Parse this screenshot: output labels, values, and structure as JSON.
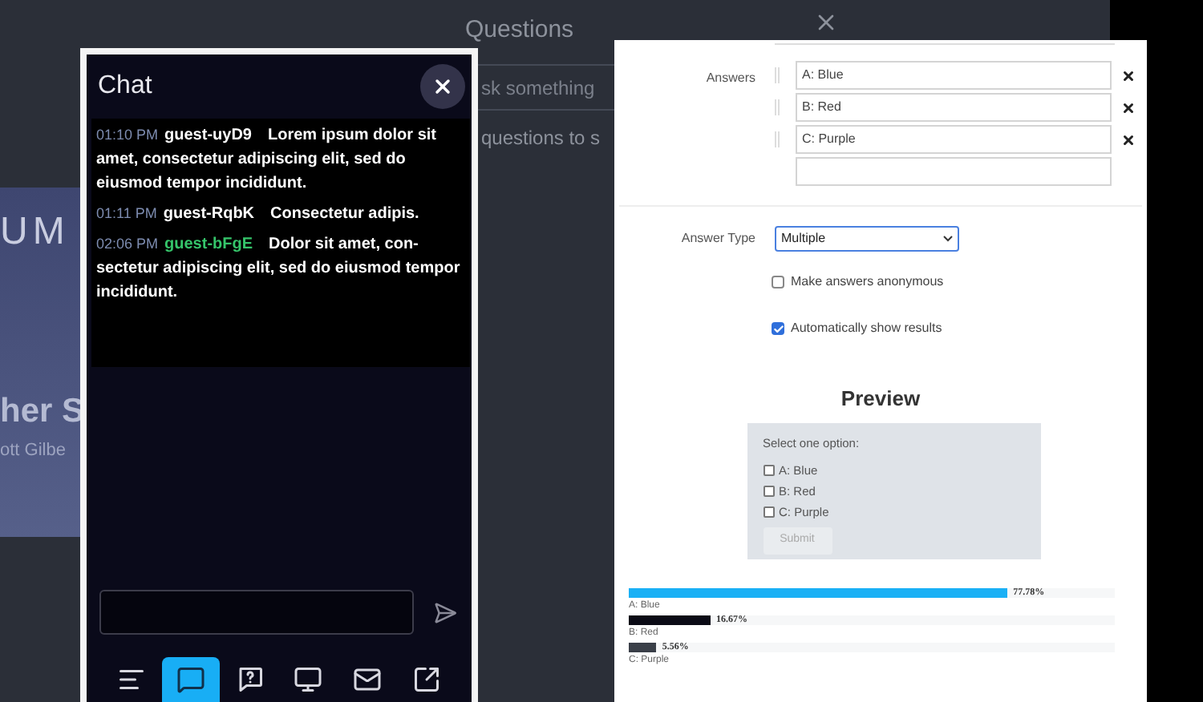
{
  "background": {
    "questions_title": "Questions",
    "question_field_text": "sk something",
    "empty_text": "questions to s",
    "slide_texts": [
      "UM",
      "her S",
      "ott Gilbe"
    ]
  },
  "chat": {
    "title": "Chat",
    "messages": [
      {
        "time": "01:10 PM",
        "user": "guest-uyD9",
        "highlight": false,
        "text": "Lorem ipsum dolor sit amet, consectetur adipiscing elit, sed do eiusmod tempor incididunt."
      },
      {
        "time": "01:11 PM",
        "user": "guest-RqbK",
        "highlight": false,
        "text": "Consectetur adipis."
      },
      {
        "time": "02:06 PM",
        "user": "guest-bFgE",
        "highlight": true,
        "text": "Dolor sit amet, con-sectetur adipiscing elit, sed do eiusmod tempor incididunt."
      }
    ],
    "toolbar": [
      {
        "kind": "list",
        "selected": false
      },
      {
        "kind": "chat",
        "selected": true
      },
      {
        "kind": "question",
        "selected": false
      },
      {
        "kind": "screen",
        "selected": false
      },
      {
        "kind": "mail",
        "selected": false
      },
      {
        "kind": "external",
        "selected": false
      }
    ]
  },
  "poll_editor": {
    "answers_label": "Answers",
    "answers": [
      {
        "value": "A: Blue"
      },
      {
        "value": "B: Red"
      },
      {
        "value": "C: Purple"
      }
    ],
    "answer_type_label": "Answer Type",
    "answer_type": "Multiple",
    "options": [
      {
        "label": "Make answers anonymous",
        "checked": false
      },
      {
        "label": "Automatically show results",
        "checked": true
      }
    ],
    "preview": {
      "title": "Preview",
      "prompt": "Select one option:",
      "choices": [
        {
          "label": "A: Blue",
          "checked": false
        },
        {
          "label": "B: Red",
          "checked": false
        },
        {
          "label": "C: Purple",
          "checked": false
        }
      ],
      "submit": "Submit"
    },
    "results": [
      {
        "label": "A: Blue",
        "reading": "77.78%",
        "level": 0.7778,
        "color": "#1ab0f5"
      },
      {
        "label": "B: Red",
        "reading": "16.67%",
        "level": 0.1667,
        "color": "#0b0b16"
      },
      {
        "label": "C: Purple",
        "reading": "5.56%",
        "level": 0.0556,
        "color": "#3a3f48"
      }
    ]
  }
}
